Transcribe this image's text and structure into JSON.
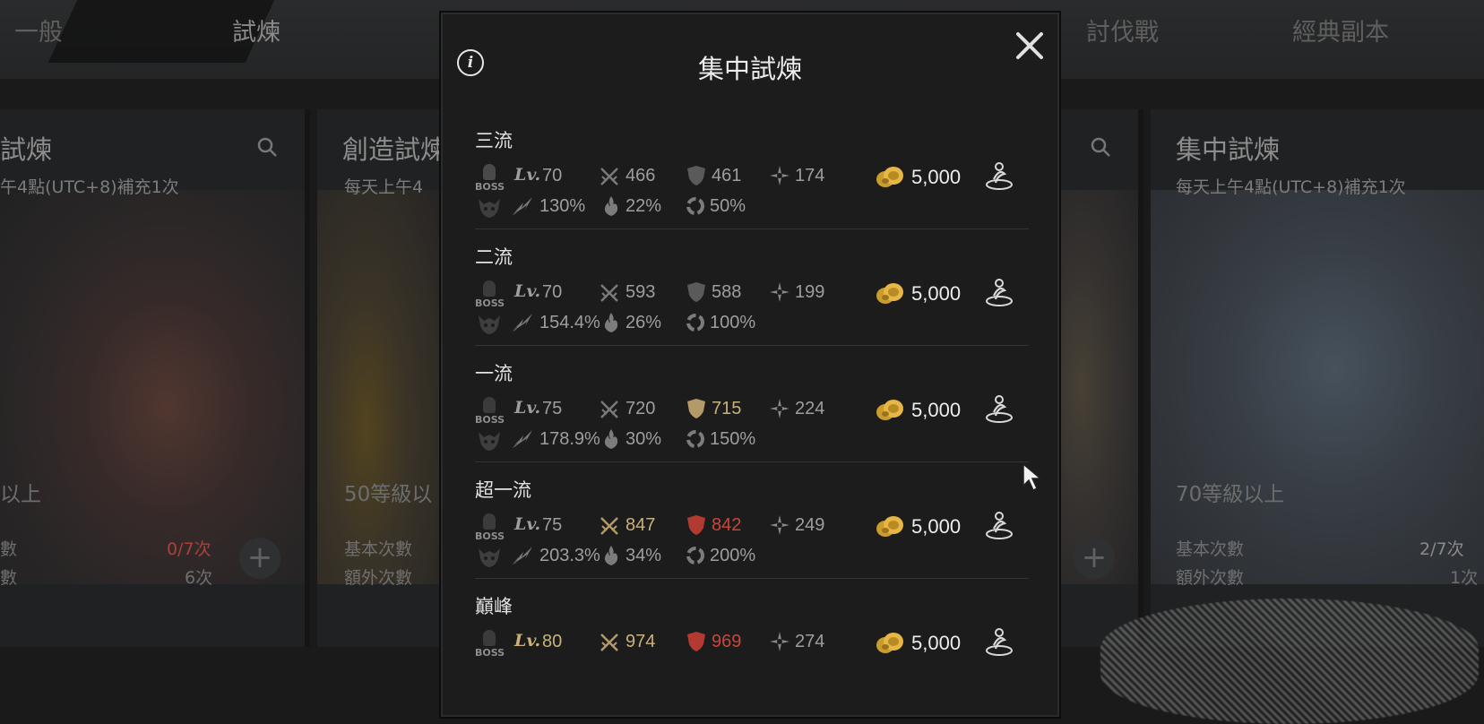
{
  "top_tabs": {
    "general": "一般",
    "trial": "試煉",
    "raid": "討伐戰",
    "classic": "經典副本"
  },
  "cards": {
    "left": {
      "title": "試煉",
      "subtitle": "午4點(UTC+8)補充1次",
      "level_req": "以上",
      "base_label": "數",
      "base_count": "0/7次",
      "extra_label": "數",
      "extra_count": "6次",
      "count_color": "#b5423a"
    },
    "creation": {
      "title": "創造試煉",
      "subtitle": "每天上午4",
      "level_req": "50等級以",
      "base_label": "基本次數",
      "extra_label": "額外次數"
    },
    "right": {
      "title": "集中試煉",
      "subtitle": "每天上午4點(UTC+8)補充1次",
      "level_req": "70等級以上",
      "base_label": "基本次數",
      "base_count": "2/7次",
      "extra_label": "額外次數",
      "extra_count": "1次"
    }
  },
  "modal": {
    "title": "集中試煉",
    "info_icon": "i",
    "close_icon": "close-icon",
    "boss_label": "BOSS",
    "lv_label": "Lv.",
    "rows": [
      {
        "tier": "三流",
        "level": "70",
        "attack": "466",
        "defense": "461",
        "spirit": "174",
        "crit": "130%",
        "fire": "22%",
        "resist": "50%",
        "reward": "5,000",
        "lv_color": "#9e9e9e",
        "attack_color": "#9e9e9e",
        "defense_color": "#9e9e9e",
        "shield_color": "#5a5a5a"
      },
      {
        "tier": "二流",
        "level": "70",
        "attack": "593",
        "defense": "588",
        "spirit": "199",
        "crit": "154.4%",
        "fire": "26%",
        "resist": "100%",
        "reward": "5,000",
        "lv_color": "#9e9e9e",
        "attack_color": "#9e9e9e",
        "defense_color": "#9e9e9e",
        "shield_color": "#5a5a5a"
      },
      {
        "tier": "一流",
        "level": "75",
        "attack": "720",
        "defense": "715",
        "spirit": "224",
        "crit": "178.9%",
        "fire": "30%",
        "resist": "150%",
        "reward": "5,000",
        "lv_color": "#9e9e9e",
        "attack_color": "#9e9e9e",
        "defense_color": "#c8b27a",
        "shield_color": "#b39a68"
      },
      {
        "tier": "超一流",
        "level": "75",
        "attack": "847",
        "defense": "842",
        "spirit": "249",
        "crit": "203.3%",
        "fire": "34%",
        "resist": "200%",
        "reward": "5,000",
        "lv_color": "#9e9e9e",
        "attack_color": "#c8b27a",
        "defense_color": "#c6473c",
        "shield_color": "#b33a30"
      },
      {
        "tier": "巔峰",
        "level": "80",
        "attack": "974",
        "defense": "969",
        "spirit": "274",
        "reward": "5,000",
        "lv_color": "#c8b27a",
        "attack_color": "#c8b27a",
        "defense_color": "#c6473c",
        "shield_color": "#b33a30"
      }
    ]
  }
}
